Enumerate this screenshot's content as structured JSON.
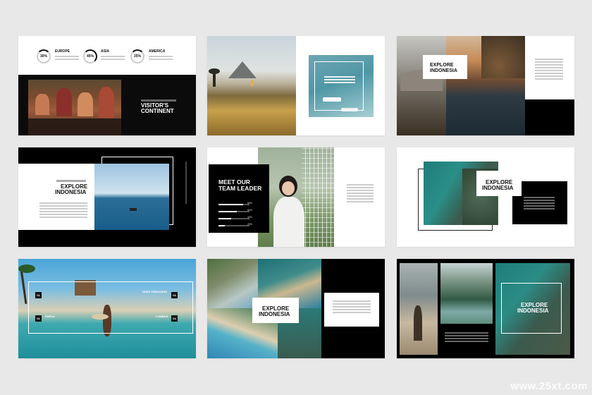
{
  "slide1": {
    "stats": [
      {
        "pct": "30%",
        "label": "EUROPE"
      },
      {
        "pct": "45%",
        "label": "ASIA"
      },
      {
        "pct": "25%",
        "label": "AMERICA"
      }
    ],
    "title_line1": "VISITOR'S",
    "title_line2": "CONTINENT"
  },
  "slide3": {
    "title_line1": "EXPLORE",
    "title_line2": "INDONESIA"
  },
  "slide4": {
    "title_line1": "EXPLORE",
    "title_line2": "INDONESIA"
  },
  "slide5": {
    "title_line1": "MEET OUR",
    "title_line2": "TEAM LEADER",
    "bars": [
      {
        "pct": "80%",
        "level": 0.8
      },
      {
        "pct": "60%",
        "level": 0.6
      },
      {
        "pct": "40%",
        "level": 0.4
      },
      {
        "pct": "20%",
        "level": 0.2
      }
    ]
  },
  "slide6": {
    "title_line1": "EXPLORE",
    "title_line2": "INDONESIA"
  },
  "slide7": {
    "regions": [
      {
        "num": "01",
        "name": "NUSA TENGGARA"
      },
      {
        "num": "02",
        "name": "PAPUA"
      },
      {
        "num": "03",
        "name": ""
      },
      {
        "num": "04",
        "name": "LOMBOK"
      }
    ],
    "badges": [
      "03",
      "01",
      "02",
      "04"
    ],
    "names": [
      "NUSA TENGGARA",
      "PAPUA",
      "LOMBOK"
    ]
  },
  "slide8": {
    "title_line1": "EXPLORE",
    "title_line2": "INDONESIA"
  },
  "slide9": {
    "title_line1": "EXPLORE",
    "title_line2": "INDONESIA"
  },
  "watermark": "www.25xt.com"
}
